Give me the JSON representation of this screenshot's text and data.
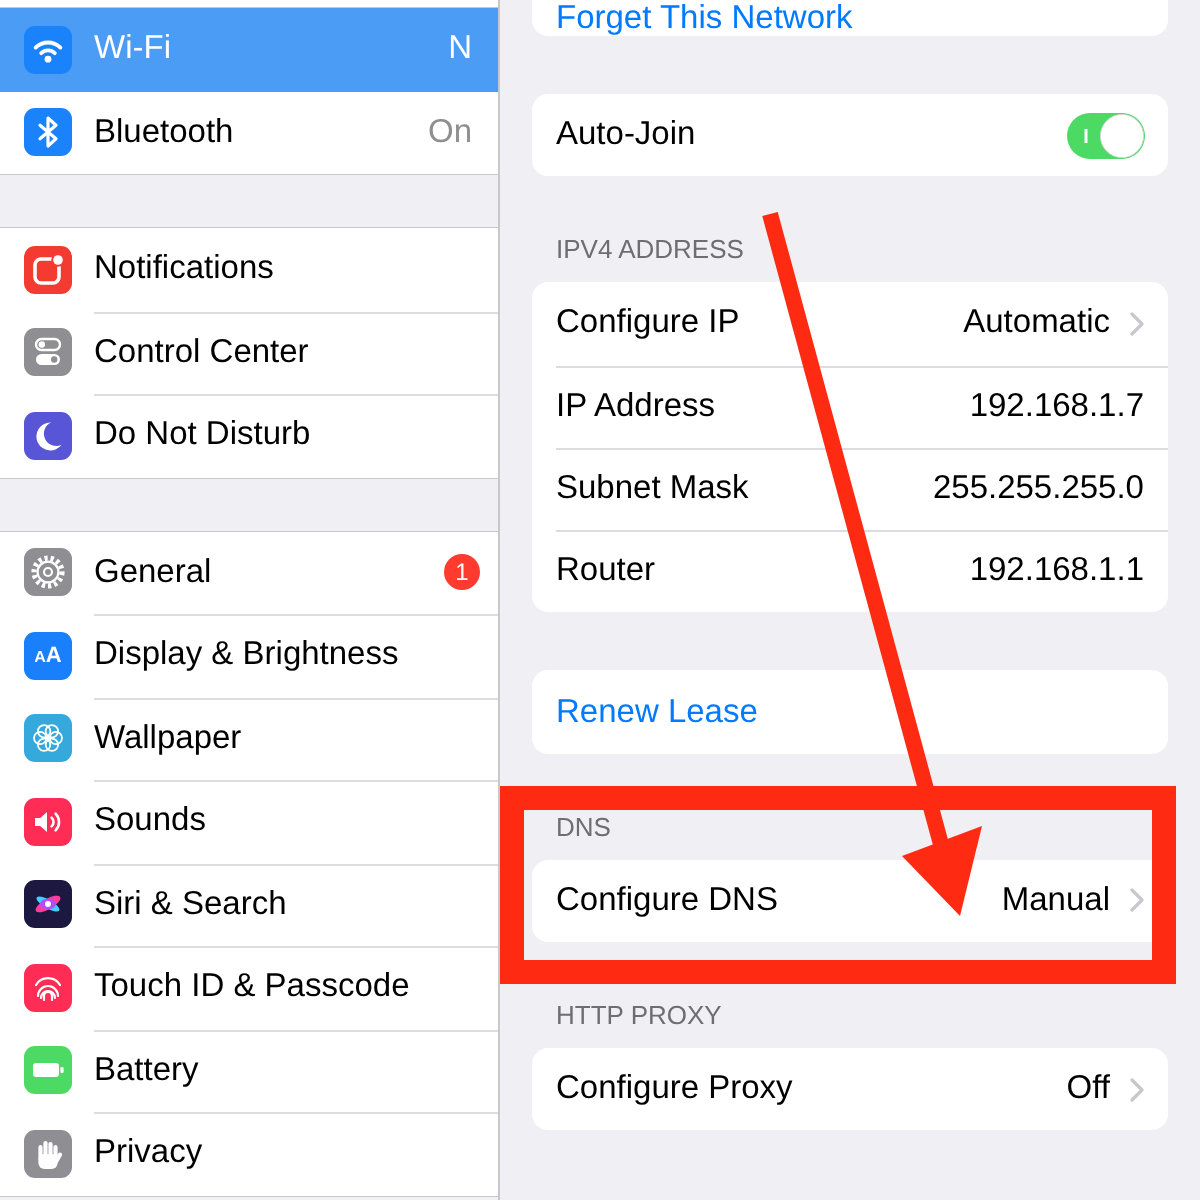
{
  "sidebar": {
    "groups": [
      {
        "items": [
          {
            "label": "Wi-Fi",
            "value": "N",
            "selected": true
          },
          {
            "label": "Bluetooth",
            "value": "On",
            "selected": false
          }
        ]
      },
      {
        "items": [
          {
            "label": "Notifications",
            "selected": false
          },
          {
            "label": "Control Center",
            "selected": false
          },
          {
            "label": "Do Not Disturb",
            "selected": false
          }
        ]
      },
      {
        "items": [
          {
            "label": "General",
            "badge": "1",
            "selected": false
          },
          {
            "label": "Display & Brightness",
            "icon_text": "AA",
            "selected": false
          },
          {
            "label": "Wallpaper",
            "selected": false
          },
          {
            "label": "Sounds",
            "selected": false
          },
          {
            "label": "Siri & Search",
            "selected": false
          },
          {
            "label": "Touch ID & Passcode",
            "selected": false
          },
          {
            "label": "Battery",
            "selected": false
          },
          {
            "label": "Privacy",
            "selected": false
          }
        ]
      }
    ]
  },
  "detail": {
    "sections": [
      {
        "highlighted": false,
        "rows": [
          {
            "kind": "link",
            "label": "Forget This Network"
          }
        ]
      },
      {
        "highlighted": false,
        "rows": [
          {
            "kind": "toggle",
            "label": "Auto-Join",
            "on": true
          }
        ]
      },
      {
        "header": "IPV4 ADDRESS",
        "highlighted": false,
        "rows": [
          {
            "kind": "disclosure",
            "label": "Configure IP",
            "value": "Automatic"
          },
          {
            "kind": "value",
            "label": "IP Address",
            "value": "192.168.1.7"
          },
          {
            "kind": "value",
            "label": "Subnet Mask",
            "value": "255.255.255.0"
          },
          {
            "kind": "value",
            "label": "Router",
            "value": "192.168.1.1"
          }
        ]
      },
      {
        "highlighted": false,
        "rows": [
          {
            "kind": "link",
            "label": "Renew Lease"
          }
        ]
      },
      {
        "header": "DNS",
        "highlighted": true,
        "rows": [
          {
            "kind": "disclosure",
            "label": "Configure DNS",
            "value": "Manual"
          }
        ]
      },
      {
        "header": "HTTP PROXY",
        "highlighted": false,
        "rows": [
          {
            "kind": "disclosure",
            "label": "Configure Proxy",
            "value": "Off"
          }
        ]
      }
    ],
    "annotations": [
      {
        "kind": "arrow"
      }
    ]
  }
}
